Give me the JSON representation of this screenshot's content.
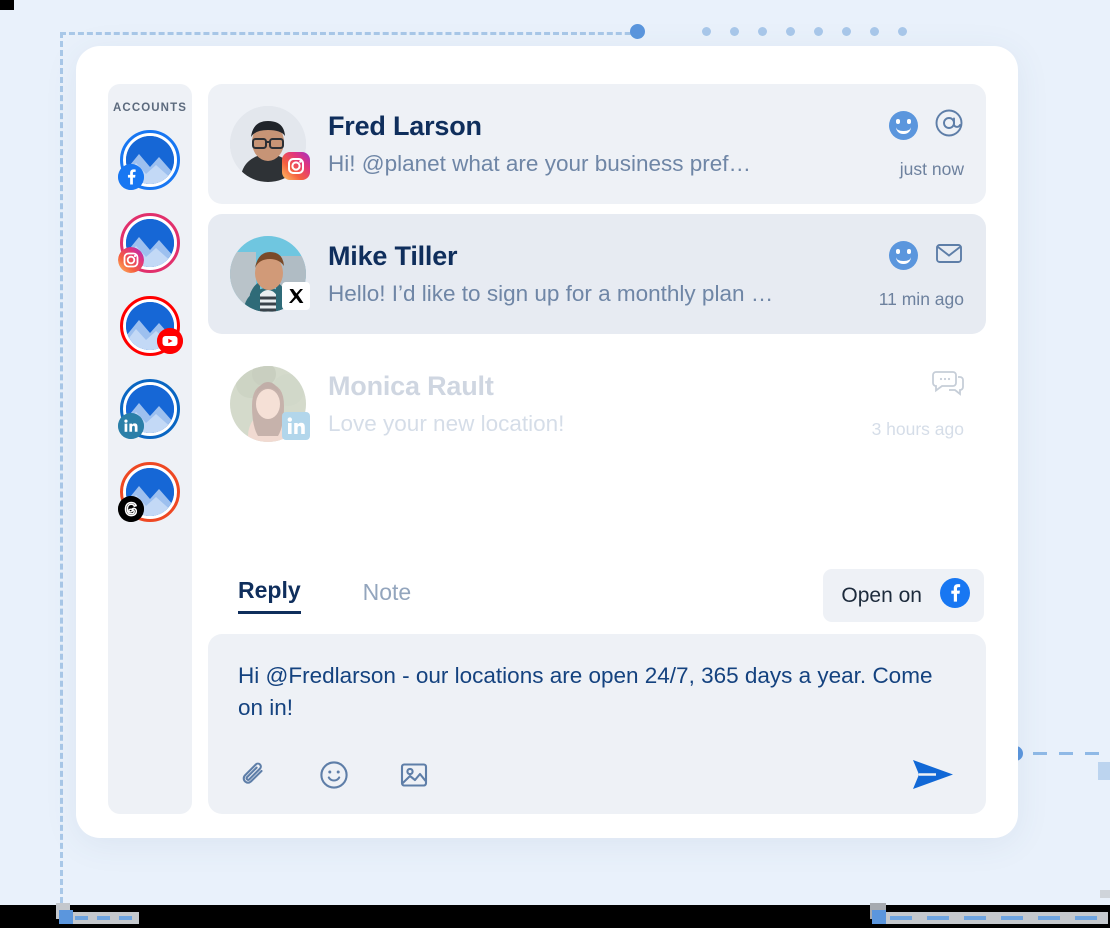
{
  "sidebar": {
    "heading": "ACCOUNTS",
    "accounts": [
      {
        "network": "facebook",
        "icon": "facebook-icon",
        "ring_color": "#1877f2",
        "badge_color": "#1877f2"
      },
      {
        "network": "instagram",
        "icon": "instagram-icon",
        "ring_color": "#e1306c",
        "badge_color": "#e1306c"
      },
      {
        "network": "youtube",
        "icon": "youtube-icon",
        "ring_color": "#ff0000",
        "badge_color": "#ff0000"
      },
      {
        "network": "linkedin",
        "icon": "linkedin-icon",
        "ring_color": "#0a66c2",
        "badge_color": "#2a7fa8"
      },
      {
        "network": "threads",
        "icon": "threads-icon",
        "ring_color": "#ee4823",
        "badge_color": "#000000"
      }
    ]
  },
  "messages": [
    {
      "name": "Fred Larson",
      "preview": "Hi! @planet what are your business pref…",
      "time": "just now",
      "network": "instagram",
      "network_icon": "instagram-icon",
      "state": "unread",
      "actions": [
        "smiley-filled-icon",
        "at-mention-icon"
      ]
    },
    {
      "name": "Mike Tiller",
      "preview": "Hello! I’d like to sign up for a monthly plan …",
      "time": "11 min ago",
      "network": "x-twitter",
      "network_icon": "x-twitter-icon",
      "state": "selected",
      "actions": [
        "smiley-filled-icon",
        "mail-icon"
      ]
    },
    {
      "name": "Monica Rault",
      "preview": "Love your new location!",
      "time": "3 hours ago",
      "network": "linkedin",
      "network_icon": "linkedin-icon",
      "state": "read",
      "actions": [
        "chat-bubble-icon"
      ]
    }
  ],
  "composer": {
    "tabs": [
      {
        "label": "Reply",
        "active": true
      },
      {
        "label": "Note",
        "active": false
      }
    ],
    "open_on": {
      "label": "Open on",
      "icon": "facebook-icon"
    },
    "reply_text": "Hi @Fredlarson - our locations are open 24/7, 365 days a year. Come on in!",
    "tools": [
      {
        "icon": "paperclip-icon",
        "name": "attach-file"
      },
      {
        "icon": "smiley-outline-icon",
        "name": "insert-emoji"
      },
      {
        "icon": "image-icon",
        "name": "insert-image"
      }
    ],
    "send": {
      "icon": "send-icon"
    }
  },
  "colors": {
    "page_background": "#e9f1fb",
    "panel_background": "#ffffff",
    "sidebar_background": "#eef1f6",
    "row_background": "#eef1f6",
    "row_selected_background": "#e7ebf2",
    "accent_blue": "#5b96dd",
    "send_blue": "#1168d6",
    "title_navy": "#0f2e5c",
    "muted_text": "#6f86a6",
    "dashed_border": "#a9c8e8"
  },
  "decor": {
    "top_dots_count": 8,
    "top_active_dot": 1
  }
}
